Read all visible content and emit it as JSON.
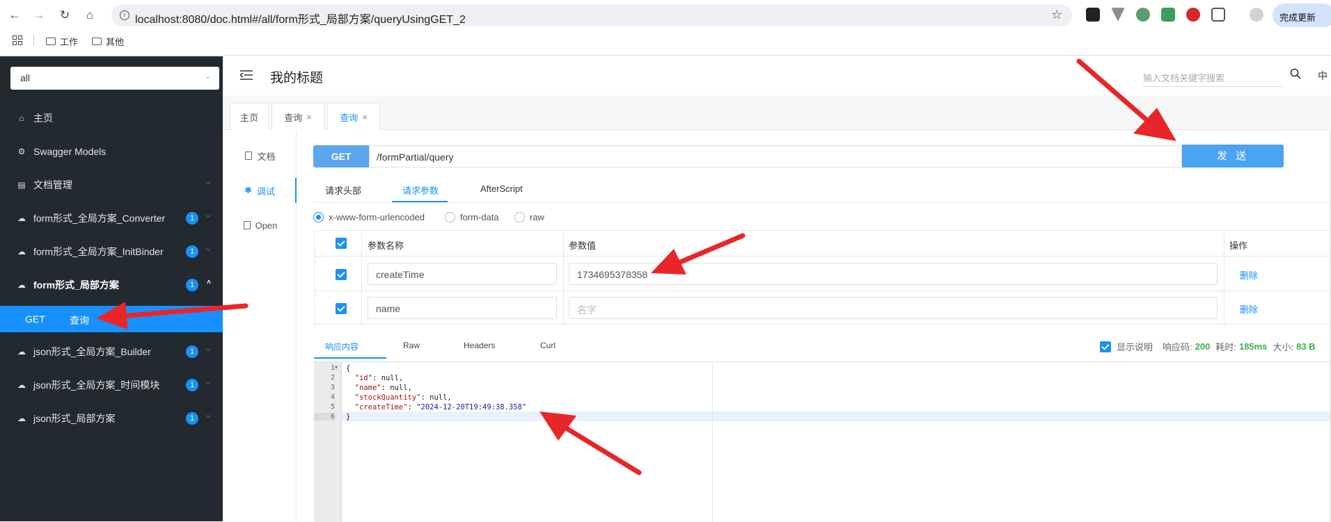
{
  "browser": {
    "url": "localhost:8080/doc.html#/all/form形式_局部方案/queryUsingGET_2",
    "update_label": "完成更新",
    "bookmarks": [
      {
        "label": "工作"
      },
      {
        "label": "其他"
      }
    ]
  },
  "sidebar": {
    "group_select": "all",
    "items": [
      {
        "label": "主页"
      },
      {
        "label": "Swagger Models"
      },
      {
        "label": "文档管理"
      },
      {
        "label": "form形式_全局方案_Converter",
        "badge": "1"
      },
      {
        "label": "form形式_全局方案_InitBinder",
        "badge": "1"
      },
      {
        "label": "form形式_局部方案",
        "badge": "1"
      },
      {
        "label": "json形式_全局方案_Builder",
        "badge": "1"
      },
      {
        "label": "json形式_全局方案_时间模块",
        "badge": "1"
      },
      {
        "label": "json形式_局部方案",
        "badge": "1"
      }
    ],
    "active_sub": {
      "method": "GET",
      "label": "查询"
    }
  },
  "header": {
    "title": "我的标题",
    "search_placeholder": "输入文档关键字搜索",
    "lang": "中"
  },
  "page_tabs": [
    {
      "label": "主页"
    },
    {
      "label": "查询"
    },
    {
      "label": "查询"
    }
  ],
  "doc_nav": [
    {
      "label": "文档"
    },
    {
      "label": "调试"
    },
    {
      "label": "Open"
    }
  ],
  "request": {
    "method": "GET",
    "path": "/formPartial/query",
    "send_label": "发 送",
    "tabs": [
      "请求头部",
      "请求参数",
      "AfterScript"
    ],
    "content_types": [
      "x-www-form-urlencoded",
      "form-data",
      "raw"
    ]
  },
  "params": {
    "headers": [
      "参数名称",
      "参数值",
      "操作"
    ],
    "rows": [
      {
        "name": "createTime",
        "value": "1734695378358",
        "placeholder": "",
        "action": "删除"
      },
      {
        "name": "name",
        "value": "",
        "placeholder": "名字",
        "action": "删除"
      }
    ]
  },
  "response": {
    "tabs": [
      "响应内容",
      "Raw",
      "Headers",
      "Curl"
    ],
    "show_desc_label": "显示说明",
    "code_label": "响应码:",
    "code": "200",
    "time_label": "耗时:",
    "time": "185ms",
    "size_label": "大小:",
    "size": "83 B",
    "line_numbers": [
      "1",
      "2",
      "3",
      "4",
      "5",
      "6"
    ],
    "lines": {
      "l1": "{",
      "id_key": "\"id\"",
      "id_val": ": null,",
      "name_key": "\"name\"",
      "name_val": ": null,",
      "stock_key": "\"stockQuantity\"",
      "stock_val": ": null,",
      "ct_key": "\"createTime\"",
      "ct_sep": ": ",
      "ct_val": "\"2024-12-20T19:49:38.358\"",
      "l6": "}"
    }
  },
  "colors": {
    "sidebar_bg": "#222a30",
    "accent": "#1890ff",
    "send_button": "#4aa3f3",
    "annotation_arrow": "#e8262a"
  }
}
